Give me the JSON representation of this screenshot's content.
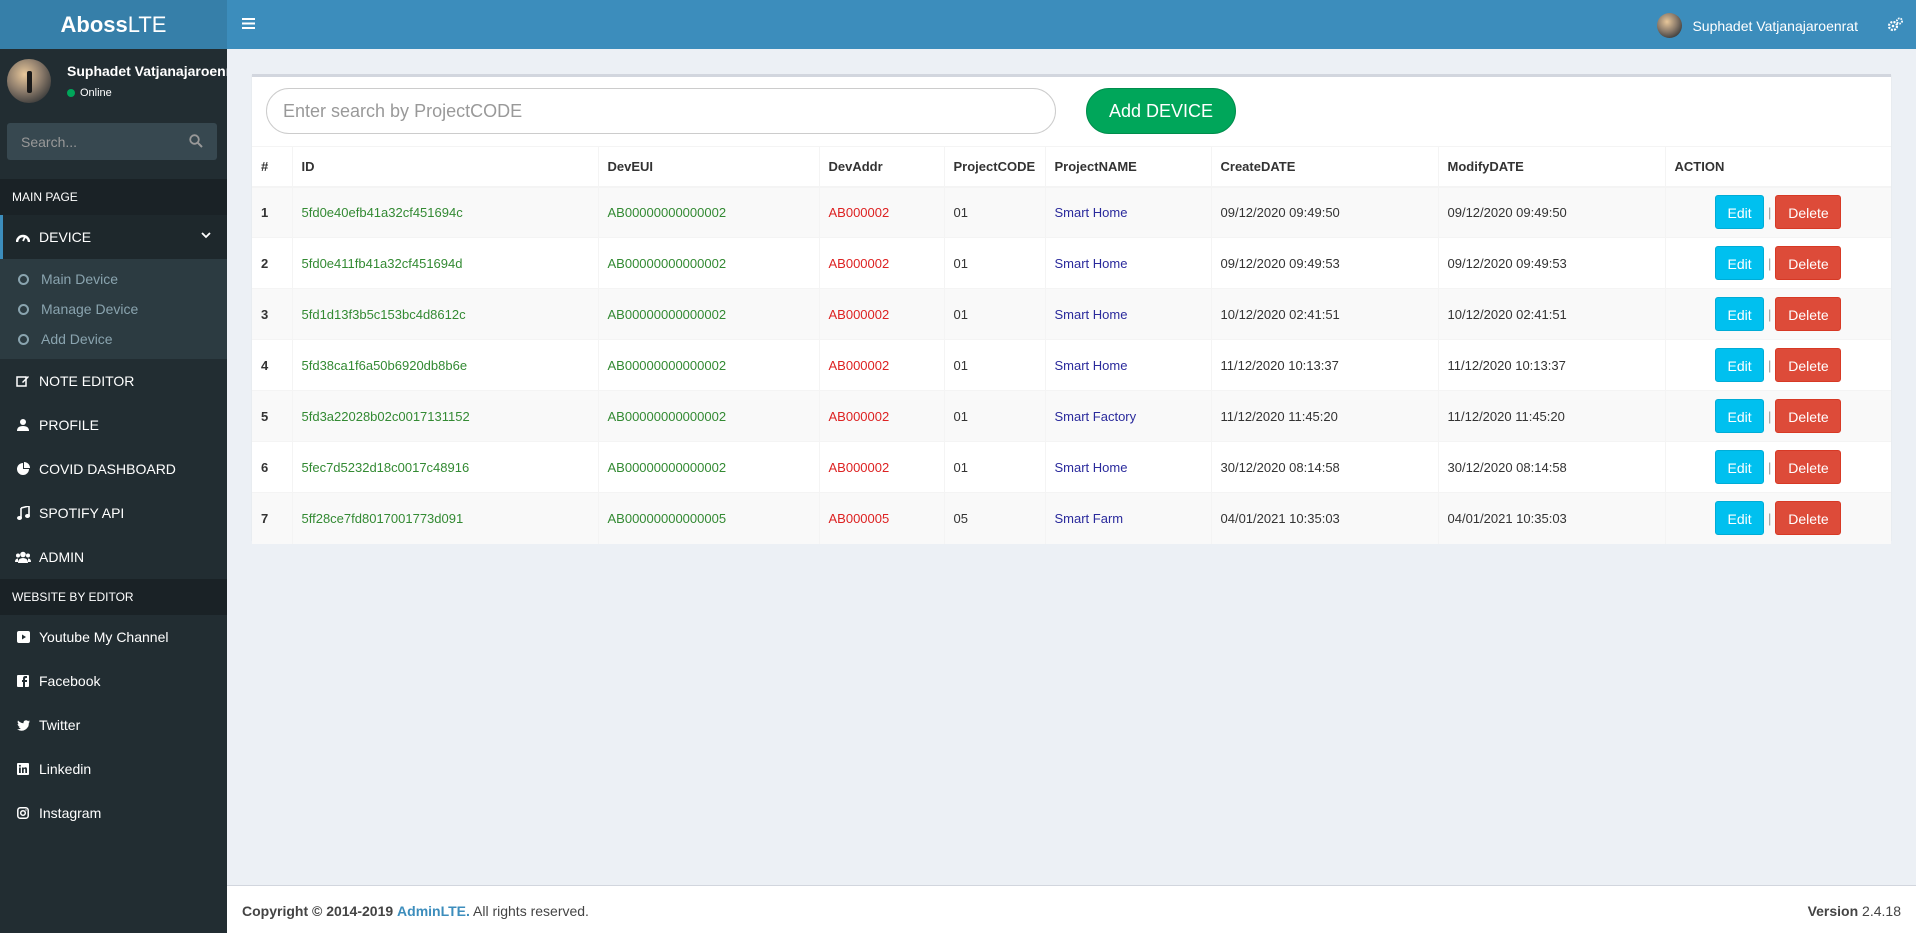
{
  "brand": {
    "bold": "Aboss",
    "light": "LTE"
  },
  "user": {
    "name": "Suphadet Vatjanajaroenrat",
    "status": "Online"
  },
  "sidebar": {
    "search_placeholder": "Search...",
    "main_header": "MAIN PAGE",
    "device": {
      "label": "DEVICE",
      "sub": [
        {
          "label": "Main Device"
        },
        {
          "label": "Manage Device"
        },
        {
          "label": "Add Device"
        }
      ]
    },
    "items": [
      {
        "label": "NOTE EDITOR",
        "icon": "edit-icon"
      },
      {
        "label": "PROFILE",
        "icon": "user-icon"
      },
      {
        "label": "COVID DASHBOARD",
        "icon": "pie-chart-icon"
      },
      {
        "label": "SPOTIFY API",
        "icon": "music-icon"
      },
      {
        "label": "ADMIN",
        "icon": "users-icon"
      }
    ],
    "website_header": "WEBSITE BY EDITOR",
    "links": [
      {
        "label": "Youtube My Channel",
        "icon": "youtube-icon"
      },
      {
        "label": "Facebook",
        "icon": "facebook-icon"
      },
      {
        "label": "Twitter",
        "icon": "twitter-icon"
      },
      {
        "label": "Linkedin",
        "icon": "linkedin-icon"
      },
      {
        "label": "Instagram",
        "icon": "instagram-icon"
      }
    ]
  },
  "navbar": {
    "user_name": "Suphadet Vatjanajaroenrat"
  },
  "main": {
    "search_placeholder": "Enter search by ProjectCODE",
    "add_button": "Add DEVICE",
    "table": {
      "headers": [
        "#",
        "ID",
        "DevEUI",
        "DevAddr",
        "ProjectCODE",
        "ProjectNAME",
        "CreateDATE",
        "ModifyDATE",
        "ACTION"
      ],
      "rows": [
        {
          "n": "1",
          "id": "5fd0e40efb41a32cf451694c",
          "deveui": "AB00000000000002",
          "devaddr": "AB000002",
          "code": "01",
          "name": "Smart Home",
          "create": "09/12/2020 09:49:50",
          "modify": "09/12/2020 09:49:50"
        },
        {
          "n": "2",
          "id": "5fd0e411fb41a32cf451694d",
          "deveui": "AB00000000000002",
          "devaddr": "AB000002",
          "code": "01",
          "name": "Smart Home",
          "create": "09/12/2020 09:49:53",
          "modify": "09/12/2020 09:49:53"
        },
        {
          "n": "3",
          "id": "5fd1d13f3b5c153bc4d8612c",
          "deveui": "AB00000000000002",
          "devaddr": "AB000002",
          "code": "01",
          "name": "Smart Home",
          "create": "10/12/2020 02:41:51",
          "modify": "10/12/2020 02:41:51"
        },
        {
          "n": "4",
          "id": "5fd38ca1f6a50b6920db8b6e",
          "deveui": "AB00000000000002",
          "devaddr": "AB000002",
          "code": "01",
          "name": "Smart Home",
          "create": "11/12/2020 10:13:37",
          "modify": "11/12/2020 10:13:37"
        },
        {
          "n": "5",
          "id": "5fd3a22028b02c0017131152",
          "deveui": "AB00000000000002",
          "devaddr": "AB000002",
          "code": "01",
          "name": "Smart Factory",
          "create": "11/12/2020 11:45:20",
          "modify": "11/12/2020 11:45:20"
        },
        {
          "n": "6",
          "id": "5fec7d5232d18c0017c48916",
          "deveui": "AB00000000000002",
          "devaddr": "AB000002",
          "code": "01",
          "name": "Smart Home",
          "create": "30/12/2020 08:14:58",
          "modify": "30/12/2020 08:14:58"
        },
        {
          "n": "7",
          "id": "5ff28ce7fd8017001773d091",
          "deveui": "AB00000000000005",
          "devaddr": "AB000005",
          "code": "05",
          "name": "Smart Farm",
          "create": "04/01/2021 10:35:03",
          "modify": "04/01/2021 10:35:03"
        }
      ],
      "edit_label": "Edit",
      "separator": "|",
      "delete_label": "Delete"
    }
  },
  "footer": {
    "copyright": "Copyright © 2014-2019",
    "brand": "AdminLTE.",
    "rights": " All rights reserved.",
    "version_label": "Version",
    "version": " 2.4.18"
  },
  "colors": {
    "navbar": "#3c8dbc",
    "logo": "#367fa9",
    "sidebar": "#222d32",
    "success": "#00a65a",
    "info": "#00c0ef",
    "danger": "#dd4b39"
  }
}
